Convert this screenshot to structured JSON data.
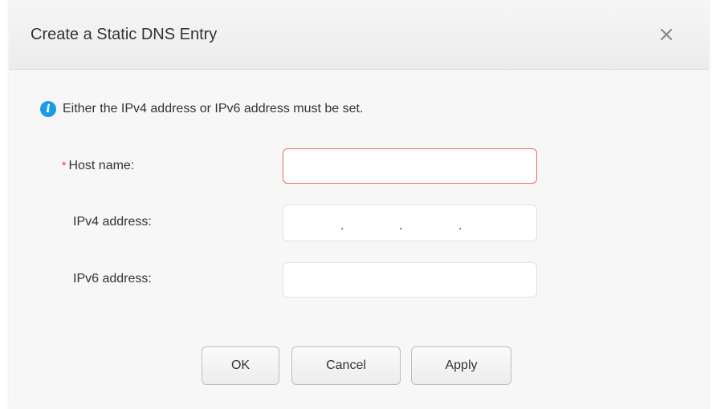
{
  "dialog": {
    "title": "Create a Static DNS Entry",
    "close_icon": "close-icon",
    "notice": {
      "icon": "info-icon",
      "icon_glyph": "i",
      "text": "Either the IPv4 address or IPv6 address must be set."
    },
    "fields": {
      "host_name": {
        "label": "Host name:",
        "required_marker": "*",
        "value": "",
        "state": "error"
      },
      "ipv4": {
        "label": "IPv4 address:",
        "separator": ".",
        "segments": [
          "",
          "",
          "",
          ""
        ]
      },
      "ipv6": {
        "label": "IPv6 address:",
        "value": ""
      }
    },
    "buttons": {
      "ok": "OK",
      "cancel": "Cancel",
      "apply": "Apply"
    }
  },
  "colors": {
    "info_blue": "#1a9be6",
    "error_border": "#ef6b62",
    "required_star": "#e33333"
  }
}
